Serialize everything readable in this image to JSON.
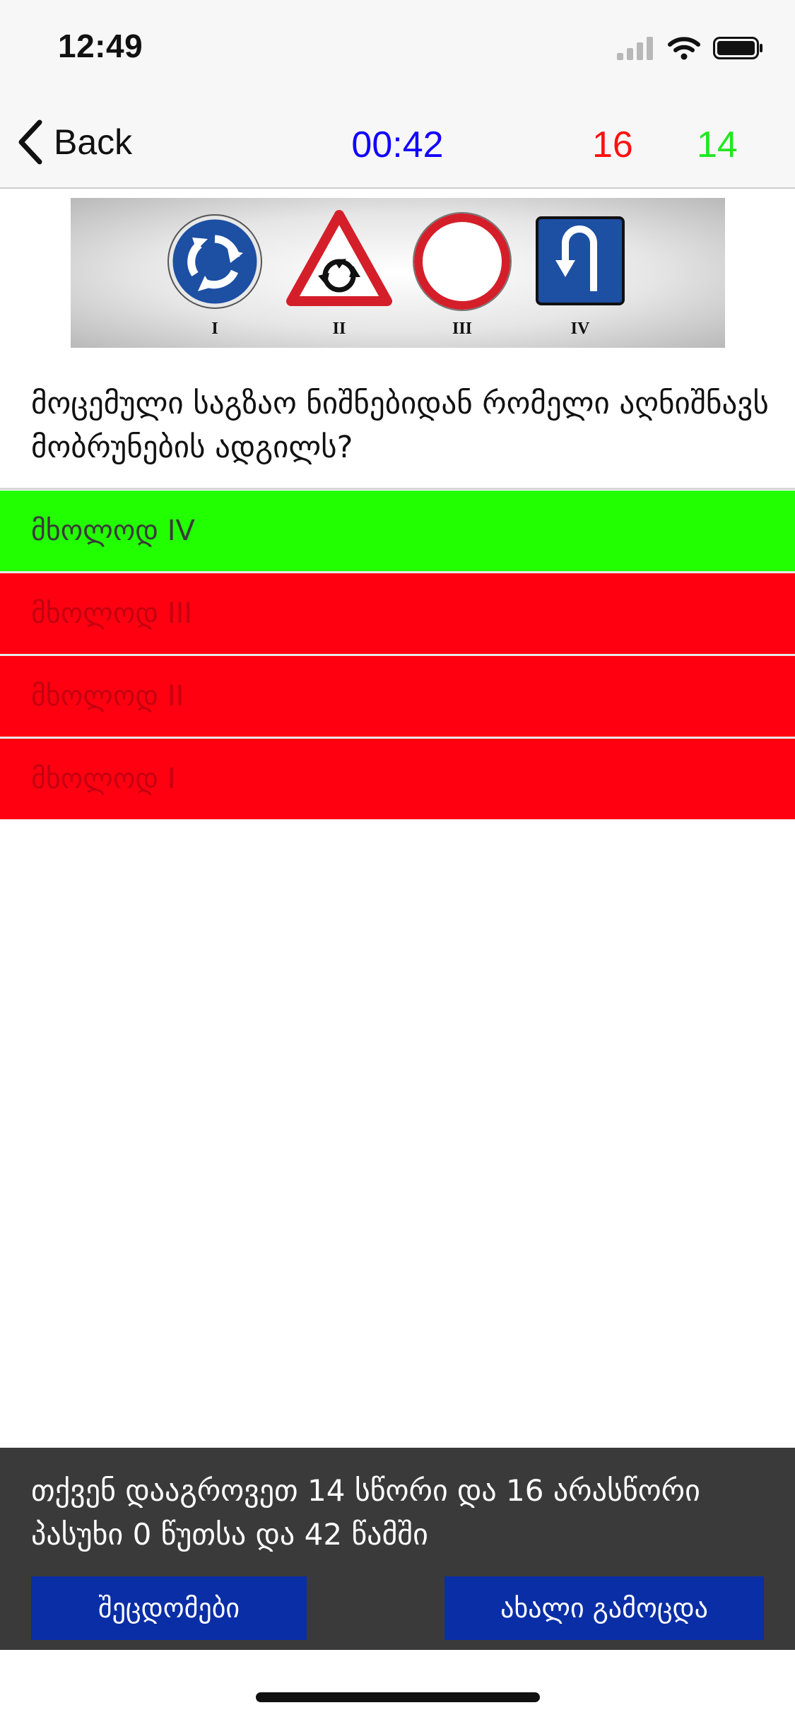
{
  "status_bar": {
    "time": "12:49",
    "icons": [
      "cellular-signal-icon",
      "wifi-icon",
      "battery-icon"
    ]
  },
  "nav": {
    "back_label": "Back",
    "timer": "00:42",
    "wrong_count": "16",
    "correct_count": "14",
    "timer_color": "#1200ff",
    "wrong_color": "#ff1010",
    "correct_color": "#1ee81e"
  },
  "sign_image": {
    "labels": [
      "I",
      "II",
      "III",
      "IV"
    ],
    "signs": [
      "roundabout-mandatory-sign",
      "roundabout-warning-sign",
      "no-vehicles-sign",
      "u-turn-place-sign"
    ]
  },
  "question": {
    "text": "მოცემული საგზაო ნიშნებიდან რომელი აღნიშნავს მობრუნების ადგილს?"
  },
  "answers": [
    {
      "label": "მხოლოდ IV",
      "state": "correct"
    },
    {
      "label": "მხოლოდ III",
      "state": "wrong"
    },
    {
      "label": "მხოლოდ II",
      "state": "wrong"
    },
    {
      "label": "მხოლოდ I",
      "state": "wrong"
    }
  ],
  "footer": {
    "result_text": "თქვენ დააგროვეთ 14 სწორი და 16 არასწორი პასუხი 0 წუთსა და 42 წამში",
    "mistakes_button": "შეცდომები",
    "new_exam_button": "ახალი გამოცდა"
  },
  "colors": {
    "correct_answer_bg": "#22ff00",
    "wrong_answer_bg": "#ff0010",
    "footer_bg": "#3a3a3a",
    "footer_button_bg": "#0a2ea6"
  }
}
